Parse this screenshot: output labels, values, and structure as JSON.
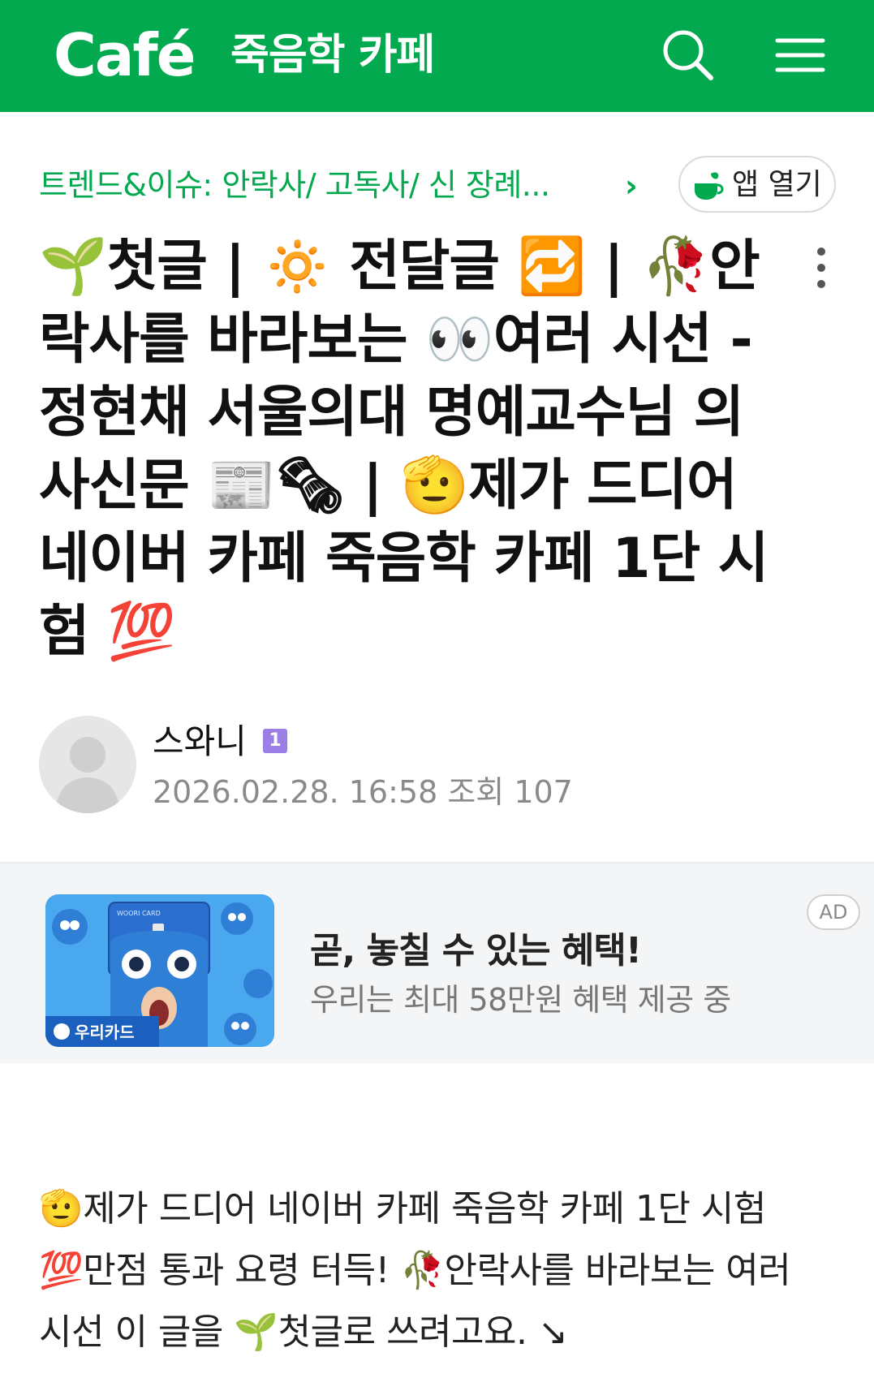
{
  "header": {
    "logo": "Café",
    "cafe_name": "죽음학 카페",
    "icons": [
      "search-icon",
      "hamburger-menu-icon"
    ]
  },
  "breadcrumb": {
    "text": "트렌드&이슈: 안락사/ 고독사/ 신 장례...",
    "chevron": "›"
  },
  "app_open": {
    "label": "앱 열기",
    "icon": "cafe-cup-icon"
  },
  "post": {
    "title": "🌱첫글 | 🔅 전달글 🔁 | 🥀안락사를 바라보는 👀여러 시선 -정현채 서울의대 명예교수님 의사신문 📰🗞 | 🫡제가 드디어 네이버 카페 죽음학 카페 1단 시험 💯",
    "author": "스와니",
    "level": "1",
    "meta": "2026.02.28. 16:58 조회 107",
    "body": "🫡제가 드디어 네이버 카페 죽음학 카페 1단 시험 💯만점 통과 요령 터득! 🥀안락사를 바라보는 여러 시선 이 글을 🌱첫글로 쓰려고요. ↘"
  },
  "ad": {
    "badge": "AD",
    "headline": "곧, 놓칠 수 있는 혜택!",
    "sub": "우리는 최대 58만원 혜택 제공 중",
    "brand": "우리카드",
    "card_text": "WOORI CARD"
  },
  "colors": {
    "brand_green": "#03a94e",
    "ad_background": "#f4f5f6",
    "level_badge": "#9b7fe6"
  }
}
